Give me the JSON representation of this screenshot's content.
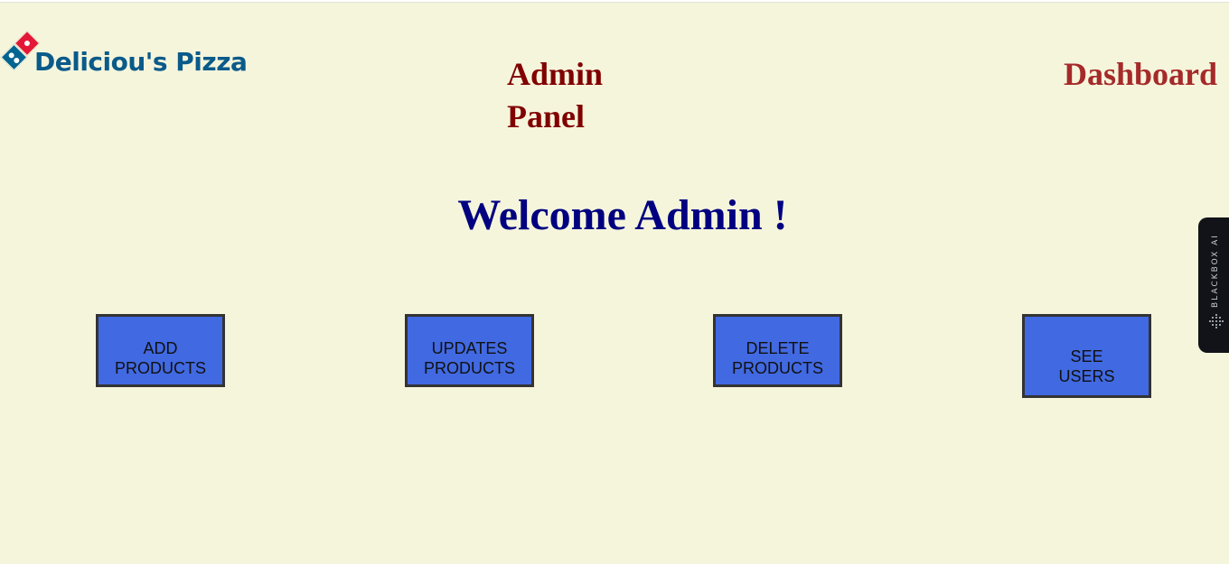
{
  "header": {
    "brand": "Deliciou's Pizza",
    "panel_title": "Admin Panel",
    "dashboard_link": "Dashboard"
  },
  "main": {
    "welcome": "Welcome Admin !",
    "actions": [
      {
        "line1": "ADD",
        "line2": "PRODUCTS"
      },
      {
        "line1": "UPDATES",
        "line2": "PRODUCTS"
      },
      {
        "line1": "DELETE",
        "line2": "PRODUCTS"
      },
      {
        "line1": "SEE",
        "line2": "USERS"
      }
    ]
  },
  "side_widget": {
    "label": "BLACKBOX AI",
    "icon": "blackbox-dots-icon"
  },
  "colors": {
    "page_background": "#f5f5dc",
    "brand_text": "#0a5a8a",
    "panel_title": "#800000",
    "dashboard": "#a52a2a",
    "welcome": "#000080",
    "button_fill": "#4169e1",
    "button_border": "#333333"
  }
}
